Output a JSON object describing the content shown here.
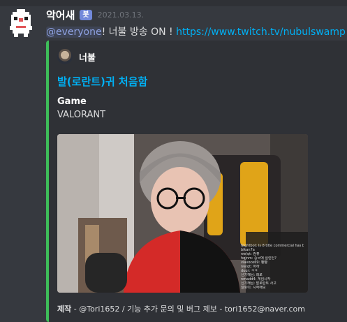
{
  "message": {
    "username": "악어새",
    "bot_tag": "봇",
    "timestamp": "2021.03.13.",
    "mention": "@everyone",
    "text": "! 너불 방송 ON ! ",
    "link": "https://www.twitch.tv/nubulswamp"
  },
  "embed": {
    "accent_color": "#3ebd59",
    "author_name": "너불",
    "title": "발(로란트)귀 처음함",
    "field_name": "Game",
    "field_value": "VALORANT",
    "footer_bold": "제작",
    "footer_text": " - @Tori1652 / 기능 추가 문의 및 버그 제보 - tori1652@naver.com"
  },
  "stream_overlay": {
    "chat_lines": [
      "Nightbot: Is 8 title commercial has been started",
      "bikan7a",
      "nw/qt: 컴퓨",
      "hqjnm: 중국애 실린턴?",
      "viavoce69: 빵빵",
      "nw/qt: 하하",
      "duqr: ㅋㅋ",
      "신기해님: 레로",
      "nmadd4: 게임시작",
      "신기해님: 발로란트 사고",
      "알로이: 시작해보"
    ]
  },
  "colors": {
    "background": "#36393f",
    "embed_background": "#2f3136",
    "link": "#00b0f4",
    "mention": "#8ea1e1",
    "bot_tag": "#7289da"
  }
}
